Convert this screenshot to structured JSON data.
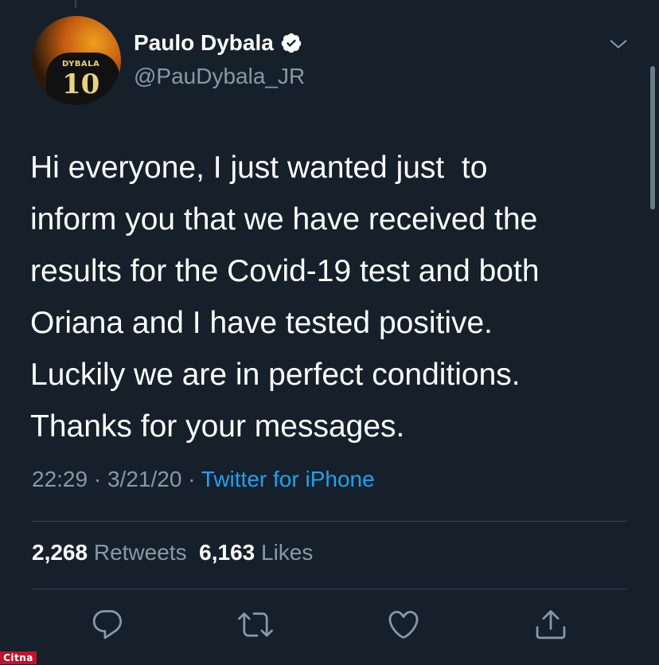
{
  "tweet": {
    "author": {
      "display_name": "Paulo Dybala",
      "handle": "@PauDybala_JR",
      "verified_icon": "verified-badge-icon",
      "avatar_shirt_name": "DYBALA",
      "avatar_shirt_number": "10"
    },
    "text_lines": [
      "Hi everyone, I just wanted just  to",
      "inform you that we have received the",
      "results for the Covid-19 test and both",
      "Oriana and I have tested positive.",
      "Luckily we are in perfect conditions.",
      "Thanks for your messages."
    ],
    "time": "22:29",
    "date": "3/21/20",
    "separator": "·",
    "source": "Twitter for iPhone",
    "stats": {
      "retweets_count": "2,268",
      "retweets_label": "Retweets",
      "likes_count": "6,163",
      "likes_label": "Likes"
    },
    "actions": [
      {
        "name": "reply-icon"
      },
      {
        "name": "retweet-icon"
      },
      {
        "name": "like-icon"
      },
      {
        "name": "share-icon"
      }
    ]
  },
  "watermark": {
    "text": "Citna"
  },
  "colors": {
    "background": "#15202b",
    "primary_text": "#ffffff",
    "secondary_text": "#8899a6",
    "accent": "#1da1f2",
    "divider": "#38444d",
    "watermark_bg": "#c0142a"
  }
}
